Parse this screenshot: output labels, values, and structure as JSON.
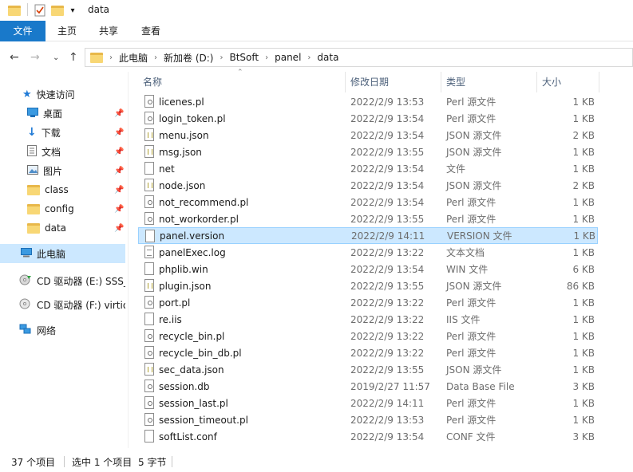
{
  "window": {
    "title": "data"
  },
  "ribbon": {
    "tabs": [
      "文件",
      "主页",
      "共享",
      "查看"
    ]
  },
  "address": {
    "crumbs": [
      "此电脑",
      "新加卷 (D:)",
      "BtSoft",
      "panel",
      "data"
    ]
  },
  "sidebar": {
    "quick_access": "快速访问",
    "pinned": [
      "桌面",
      "下载",
      "文档",
      "图片",
      "class",
      "config",
      "data"
    ],
    "this_pc": "此电脑",
    "cd_e": "CD 驱动器 (E:) SSS_X",
    "cd_f": "CD 驱动器 (F:) virtio",
    "network": "网络"
  },
  "columns": {
    "name": "名称",
    "date": "修改日期",
    "type": "类型",
    "size": "大小"
  },
  "files": [
    {
      "name": "licenes.pl",
      "date": "2022/2/9 13:53",
      "type": "Perl 源文件",
      "size": "1 KB",
      "icon": "gear"
    },
    {
      "name": "login_token.pl",
      "date": "2022/2/9 13:54",
      "type": "Perl 源文件",
      "size": "1 KB",
      "icon": "gear"
    },
    {
      "name": "menu.json",
      "date": "2022/2/9 13:54",
      "type": "JSON 源文件",
      "size": "2 KB",
      "icon": "json"
    },
    {
      "name": "msg.json",
      "date": "2022/2/9 13:55",
      "type": "JSON 源文件",
      "size": "1 KB",
      "icon": "json"
    },
    {
      "name": "net",
      "date": "2022/2/9 13:54",
      "type": "文件",
      "size": "1 KB",
      "icon": "blank"
    },
    {
      "name": "node.json",
      "date": "2022/2/9 13:54",
      "type": "JSON 源文件",
      "size": "2 KB",
      "icon": "json"
    },
    {
      "name": "not_recommend.pl",
      "date": "2022/2/9 13:54",
      "type": "Perl 源文件",
      "size": "1 KB",
      "icon": "gear"
    },
    {
      "name": "not_workorder.pl",
      "date": "2022/2/9 13:55",
      "type": "Perl 源文件",
      "size": "1 KB",
      "icon": "gear"
    },
    {
      "name": "panel.version",
      "date": "2022/2/9 14:11",
      "type": "VERSION 文件",
      "size": "1 KB",
      "icon": "blank",
      "selected": true
    },
    {
      "name": "panelExec.log",
      "date": "2022/2/9 13:22",
      "type": "文本文档",
      "size": "1 KB",
      "icon": "text"
    },
    {
      "name": "phplib.win",
      "date": "2022/2/9 13:54",
      "type": "WIN 文件",
      "size": "6 KB",
      "icon": "blank"
    },
    {
      "name": "plugin.json",
      "date": "2022/2/9 13:55",
      "type": "JSON 源文件",
      "size": "86 KB",
      "icon": "json"
    },
    {
      "name": "port.pl",
      "date": "2022/2/9 13:22",
      "type": "Perl 源文件",
      "size": "1 KB",
      "icon": "gear"
    },
    {
      "name": "re.iis",
      "date": "2022/2/9 13:22",
      "type": "IIS 文件",
      "size": "1 KB",
      "icon": "blank"
    },
    {
      "name": "recycle_bin.pl",
      "date": "2022/2/9 13:22",
      "type": "Perl 源文件",
      "size": "1 KB",
      "icon": "gear"
    },
    {
      "name": "recycle_bin_db.pl",
      "date": "2022/2/9 13:22",
      "type": "Perl 源文件",
      "size": "1 KB",
      "icon": "gear"
    },
    {
      "name": "sec_data.json",
      "date": "2022/2/9 13:55",
      "type": "JSON 源文件",
      "size": "1 KB",
      "icon": "json"
    },
    {
      "name": "session.db",
      "date": "2019/2/27 11:57",
      "type": "Data Base File",
      "size": "3 KB",
      "icon": "gear"
    },
    {
      "name": "session_last.pl",
      "date": "2022/2/9 14:11",
      "type": "Perl 源文件",
      "size": "1 KB",
      "icon": "gear"
    },
    {
      "name": "session_timeout.pl",
      "date": "2022/2/9 13:53",
      "type": "Perl 源文件",
      "size": "1 KB",
      "icon": "gear"
    },
    {
      "name": "softList.conf",
      "date": "2022/2/9 13:54",
      "type": "CONF 文件",
      "size": "3 KB",
      "icon": "blank"
    }
  ],
  "status": {
    "count": "37 个项目",
    "selected": "选中 1 个项目",
    "size": "5 字节"
  }
}
